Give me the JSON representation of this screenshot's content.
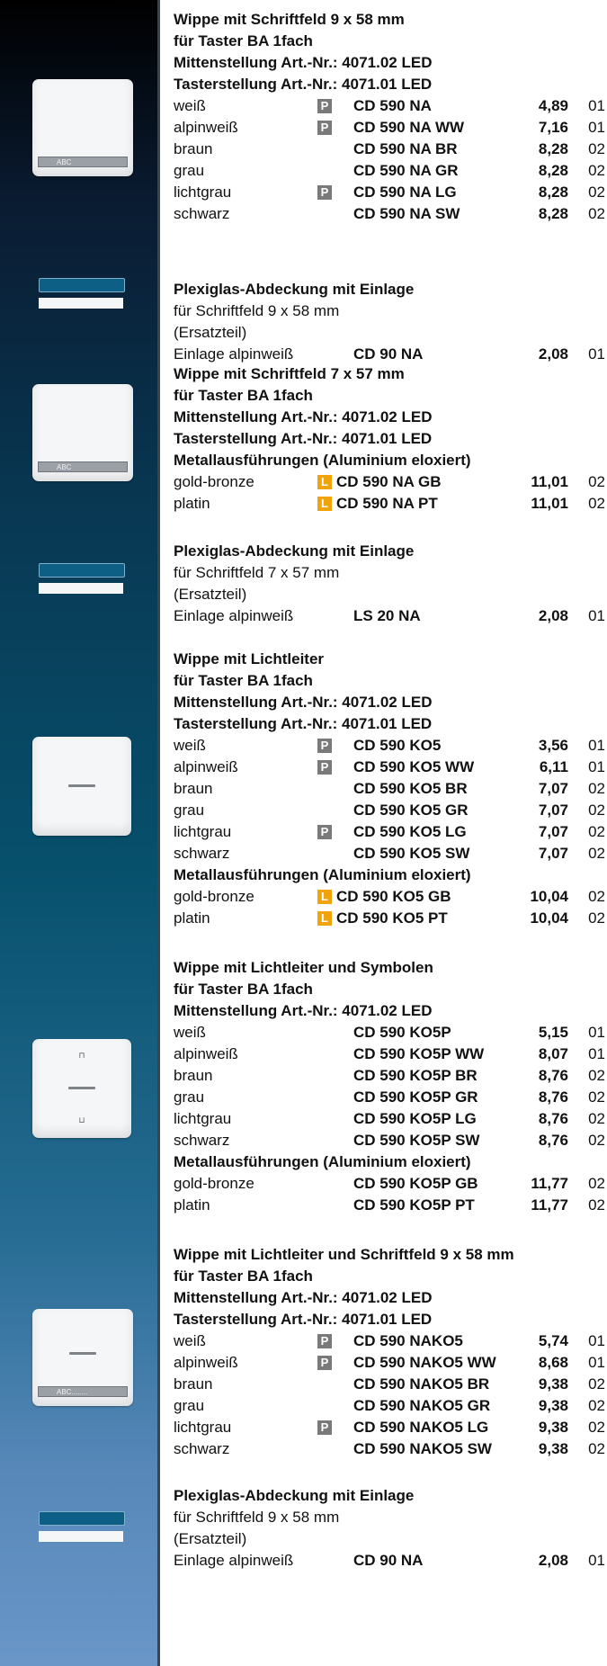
{
  "sections": [
    {
      "lines": [
        {
          "text": "Wippe mit Schriftfeld 9 x 58 mm",
          "bold": true
        },
        {
          "text": "für Taster BA 1fach",
          "bold": true
        },
        {
          "text": "Mittenstellung Art.-Nr.: 4071.02 LED",
          "bold": true
        },
        {
          "text": "Tasterstellung Art.-Nr.: 4071.01 LED",
          "bold": true
        }
      ],
      "rows": [
        {
          "name": "weiß",
          "badge": "P",
          "code": "CD 590 NA",
          "price": "4,89",
          "group": "01"
        },
        {
          "name": "alpinweiß",
          "badge": "P",
          "code": "CD 590 NA WW",
          "price": "7,16",
          "group": "01"
        },
        {
          "name": "braun",
          "badge": "",
          "code": "CD 590 NA BR",
          "price": "8,28",
          "group": "02"
        },
        {
          "name": "grau",
          "badge": "",
          "code": "CD 590 NA GR",
          "price": "8,28",
          "group": "02"
        },
        {
          "name": "lichtgrau",
          "badge": "P",
          "code": "CD 590 NA LG",
          "price": "8,28",
          "group": "02"
        },
        {
          "name": "schwarz",
          "badge": "",
          "code": "CD 590 NA SW",
          "price": "8,28",
          "group": "02"
        }
      ]
    },
    {
      "lines": [
        {
          "text": "Plexiglas-Abdeckung mit Einlage",
          "bold": true
        },
        {
          "text": "für Schriftfeld 9 x 58 mm",
          "bold": false
        },
        {
          "text": "(Ersatzteil)",
          "bold": false
        }
      ],
      "rows": [
        {
          "name": "Einlage alpinweiß",
          "badge": "",
          "code": "CD 90 NA",
          "price": "2,08",
          "group": "01"
        }
      ]
    },
    {
      "lines": [
        {
          "text": "Wippe mit Schriftfeld 7 x 57 mm",
          "bold": true
        },
        {
          "text": "für Taster BA 1fach",
          "bold": true
        },
        {
          "text": "Mittenstellung Art.-Nr.: 4071.02 LED",
          "bold": true
        },
        {
          "text": "Tasterstellung Art.-Nr.: 4071.01 LED",
          "bold": true
        },
        {
          "text": "Metallausführungen (Aluminium eloxiert)",
          "bold": true
        }
      ],
      "rows": [
        {
          "name": "gold-bronze",
          "badge": "L",
          "code": "CD 590 NA GB",
          "price": "11,01",
          "group": "02"
        },
        {
          "name": "platin",
          "badge": "L",
          "code": "CD 590 NA PT",
          "price": "11,01",
          "group": "02"
        }
      ]
    },
    {
      "lines": [
        {
          "text": "Plexiglas-Abdeckung mit Einlage",
          "bold": true
        },
        {
          "text": "für Schriftfeld 7 x 57 mm",
          "bold": false
        },
        {
          "text": "(Ersatzteil)",
          "bold": false
        }
      ],
      "rows": [
        {
          "name": "Einlage alpinweiß",
          "badge": "",
          "code": "LS 20 NA",
          "price": "2,08",
          "group": "01"
        }
      ]
    },
    {
      "lines": [
        {
          "text": "Wippe mit Lichtleiter",
          "bold": true
        },
        {
          "text": "für Taster BA 1fach",
          "bold": true
        },
        {
          "text": "Mittenstellung Art.-Nr.: 4071.02 LED",
          "bold": true
        },
        {
          "text": "Tasterstellung Art.-Nr.: 4071.01 LED",
          "bold": true
        }
      ],
      "rows": [
        {
          "name": "weiß",
          "badge": "P",
          "code": "CD 590 KO5",
          "price": "3,56",
          "group": "01"
        },
        {
          "name": "alpinweiß",
          "badge": "P",
          "code": "CD 590 KO5 WW",
          "price": "6,11",
          "group": "01"
        },
        {
          "name": "braun",
          "badge": "",
          "code": "CD 590 KO5 BR",
          "price": "7,07",
          "group": "02"
        },
        {
          "name": "grau",
          "badge": "",
          "code": "CD 590 KO5 GR",
          "price": "7,07",
          "group": "02"
        },
        {
          "name": "lichtgrau",
          "badge": "P",
          "code": "CD 590 KO5 LG",
          "price": "7,07",
          "group": "02"
        },
        {
          "name": "schwarz",
          "badge": "",
          "code": "CD 590 KO5 SW",
          "price": "7,07",
          "group": "02"
        }
      ],
      "sublines": [
        {
          "text": "Metallausführungen (Aluminium eloxiert)",
          "bold": true
        }
      ],
      "subrows": [
        {
          "name": "gold-bronze",
          "badge": "L",
          "code": "CD 590 KO5 GB",
          "price": "10,04",
          "group": "02"
        },
        {
          "name": "platin",
          "badge": "L",
          "code": "CD 590 KO5 PT",
          "price": "10,04",
          "group": "02"
        }
      ]
    },
    {
      "lines": [
        {
          "text": "Wippe mit Lichtleiter und Symbolen",
          "bold": true
        },
        {
          "text": "für Taster BA 1fach",
          "bold": true
        },
        {
          "text": "Mittenstellung Art.-Nr.: 4071.02 LED",
          "bold": true
        }
      ],
      "rows": [
        {
          "name": "weiß",
          "badge": "",
          "code": "CD 590 KO5P",
          "price": "5,15",
          "group": "01"
        },
        {
          "name": "alpinweiß",
          "badge": "",
          "code": "CD 590 KO5P WW",
          "price": "8,07",
          "group": "01"
        },
        {
          "name": "braun",
          "badge": "",
          "code": "CD 590 KO5P BR",
          "price": "8,76",
          "group": "02"
        },
        {
          "name": "grau",
          "badge": "",
          "code": "CD 590 KO5P GR",
          "price": "8,76",
          "group": "02"
        },
        {
          "name": "lichtgrau",
          "badge": "",
          "code": "CD 590 KO5P LG",
          "price": "8,76",
          "group": "02"
        },
        {
          "name": "schwarz",
          "badge": "",
          "code": "CD 590 KO5P SW",
          "price": "8,76",
          "group": "02"
        }
      ],
      "sublines": [
        {
          "text": "Metallausführungen (Aluminium eloxiert)",
          "bold": true
        }
      ],
      "subrows": [
        {
          "name": "gold-bronze",
          "badge": "",
          "code": "CD 590 KO5P GB",
          "price": "11,77",
          "group": "02"
        },
        {
          "name": "platin",
          "badge": "",
          "code": "CD 590 KO5P PT",
          "price": "11,77",
          "group": "02"
        }
      ]
    },
    {
      "lines": [
        {
          "text": "Wippe mit Lichtleiter und Schriftfeld 9 x 58 mm",
          "bold": true
        },
        {
          "text": "für Taster BA 1fach",
          "bold": true
        },
        {
          "text": "Mittenstellung Art.-Nr.: 4071.02 LED",
          "bold": true
        },
        {
          "text": "Tasterstellung Art.-Nr.: 4071.01 LED",
          "bold": true
        }
      ],
      "rows": [
        {
          "name": "weiß",
          "badge": "P",
          "code": "CD 590 NAKO5",
          "price": "5,74",
          "group": "01"
        },
        {
          "name": "alpinweiß",
          "badge": "P",
          "code": "CD 590 NAKO5 WW",
          "price": "8,68",
          "group": "01"
        },
        {
          "name": "braun",
          "badge": "",
          "code": "CD 590 NAKO5 BR",
          "price": "9,38",
          "group": "02"
        },
        {
          "name": "grau",
          "badge": "",
          "code": "CD 590 NAKO5 GR",
          "price": "9,38",
          "group": "02"
        },
        {
          "name": "lichtgrau",
          "badge": "P",
          "code": "CD 590 NAKO5 LG",
          "price": "9,38",
          "group": "02"
        },
        {
          "name": "schwarz",
          "badge": "",
          "code": "CD 590 NAKO5 SW",
          "price": "9,38",
          "group": "02"
        }
      ]
    },
    {
      "lines": [
        {
          "text": "Plexiglas-Abdeckung mit Einlage",
          "bold": true
        },
        {
          "text": "für Schriftfeld 9 x 58 mm",
          "bold": false
        },
        {
          "text": "(Ersatzteil)",
          "bold": false
        }
      ],
      "rows": [
        {
          "name": "Einlage alpinweiß",
          "badge": "",
          "code": "CD 90 NA",
          "price": "2,08",
          "group": "01"
        }
      ]
    }
  ],
  "thumbnails": {
    "label_abc": "ABC",
    "label_abc_dots": "ABC........",
    "symbol_up": "⊓",
    "symbol_down": "⊔"
  },
  "colors": {
    "badge_p": "#7a7a7a",
    "badge_l": "#f0a30a"
  }
}
